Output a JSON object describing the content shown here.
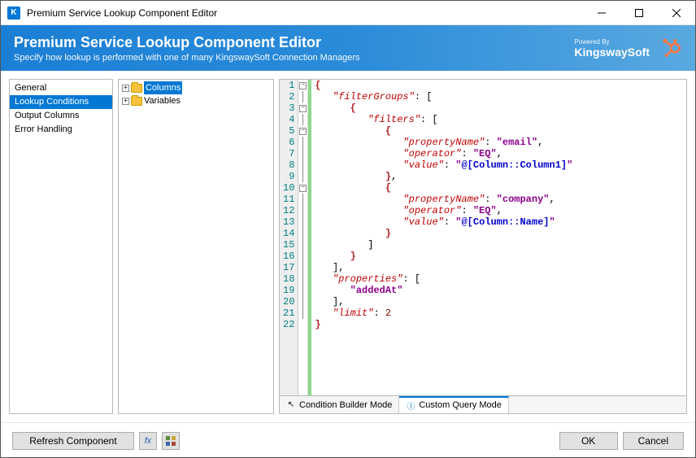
{
  "window": {
    "title": "Premium Service Lookup Component Editor",
    "app_icon_letter": "K"
  },
  "header": {
    "title": "Premium Service Lookup Component Editor",
    "subtitle": "Specify how lookup is performed with one of many KingswaySoft Connection Managers",
    "powered_by_label": "Powered By",
    "brand": "KingswaySoft"
  },
  "nav": {
    "items": [
      {
        "label": "General",
        "selected": false
      },
      {
        "label": "Lookup Conditions",
        "selected": true
      },
      {
        "label": "Output Columns",
        "selected": false
      },
      {
        "label": "Error Handling",
        "selected": false
      }
    ]
  },
  "tree": {
    "nodes": [
      {
        "label": "Columns",
        "selected": true
      },
      {
        "label": "Variables",
        "selected": false
      }
    ]
  },
  "editor": {
    "lines": [
      {
        "n": 1,
        "fold": "box",
        "html": "<span class='brace'>{</span>"
      },
      {
        "n": 2,
        "fold": "line",
        "html": "   <span class='key'>\"filterGroups\"</span>: ["
      },
      {
        "n": 3,
        "fold": "box",
        "html": "      <span class='brace'>{</span>"
      },
      {
        "n": 4,
        "fold": "line",
        "html": "         <span class='key'>\"filters\"</span>: ["
      },
      {
        "n": 5,
        "fold": "box",
        "html": "            <span class='brace'>{</span>"
      },
      {
        "n": 6,
        "fold": "line",
        "html": "               <span class='key'>\"propertyName\"</span>: <span class='str'>\"email\"</span>,"
      },
      {
        "n": 7,
        "fold": "line",
        "html": "               <span class='key'>\"operator\"</span>: <span class='str'>\"EQ\"</span>,"
      },
      {
        "n": 8,
        "fold": "line",
        "html": "               <span class='key'>\"value\"</span>: <span class='str'>\"</span><span class='var'>@[Column::Column1]</span><span class='str'>\"</span>"
      },
      {
        "n": 9,
        "fold": "line",
        "html": "            <span class='brace'>}</span>,"
      },
      {
        "n": 10,
        "fold": "box",
        "html": "            <span class='brace'>{</span>"
      },
      {
        "n": 11,
        "fold": "line",
        "html": "               <span class='key'>\"propertyName\"</span>: <span class='str'>\"company\"</span>,"
      },
      {
        "n": 12,
        "fold": "line",
        "html": "               <span class='key'>\"operator\"</span>: <span class='str'>\"EQ\"</span>,"
      },
      {
        "n": 13,
        "fold": "line",
        "html": "               <span class='key'>\"value\"</span>: <span class='str'>\"</span><span class='var'>@[Column::Name]</span><span class='str'>\"</span>"
      },
      {
        "n": 14,
        "fold": "line",
        "html": "            <span class='brace'>}</span>"
      },
      {
        "n": 15,
        "fold": "line",
        "html": "         ]"
      },
      {
        "n": 16,
        "fold": "line",
        "html": "      <span class='brace'>}</span>"
      },
      {
        "n": 17,
        "fold": "line",
        "html": "   ],"
      },
      {
        "n": 18,
        "fold": "line",
        "html": "   <span class='key'>\"properties\"</span>: ["
      },
      {
        "n": 19,
        "fold": "line",
        "html": "      <span class='str'>\"addedAt\"</span>"
      },
      {
        "n": 20,
        "fold": "line",
        "html": "   ],"
      },
      {
        "n": 21,
        "fold": "line",
        "html": "   <span class='key'>\"limit\"</span>: <span class='num'>2</span>"
      },
      {
        "n": 22,
        "fold": "",
        "html": "<span class='brace'>}</span>"
      }
    ]
  },
  "modes": {
    "builder": "Condition Builder Mode",
    "custom": "Custom Query Mode"
  },
  "footer": {
    "refresh": "Refresh Component",
    "ok": "OK",
    "cancel": "Cancel"
  }
}
